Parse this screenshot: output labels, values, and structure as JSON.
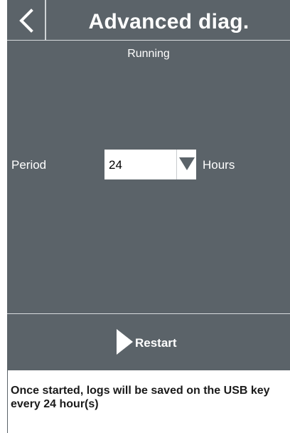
{
  "header": {
    "title": "Advanced diag.",
    "back_icon": "chevron-left-icon"
  },
  "status": {
    "text": "Running"
  },
  "period": {
    "label": "Period",
    "value": "24",
    "unit": "Hours",
    "dropdown_icon": "triangle-down-icon"
  },
  "restart": {
    "label": "Restart",
    "icon": "play-icon"
  },
  "info": {
    "text": "Once started, logs will be saved on the USB key every 24 hour(s)"
  },
  "colors": {
    "panel": "#5b6369",
    "text": "#ffffff",
    "dropdown_arrow": "#5b6369"
  }
}
